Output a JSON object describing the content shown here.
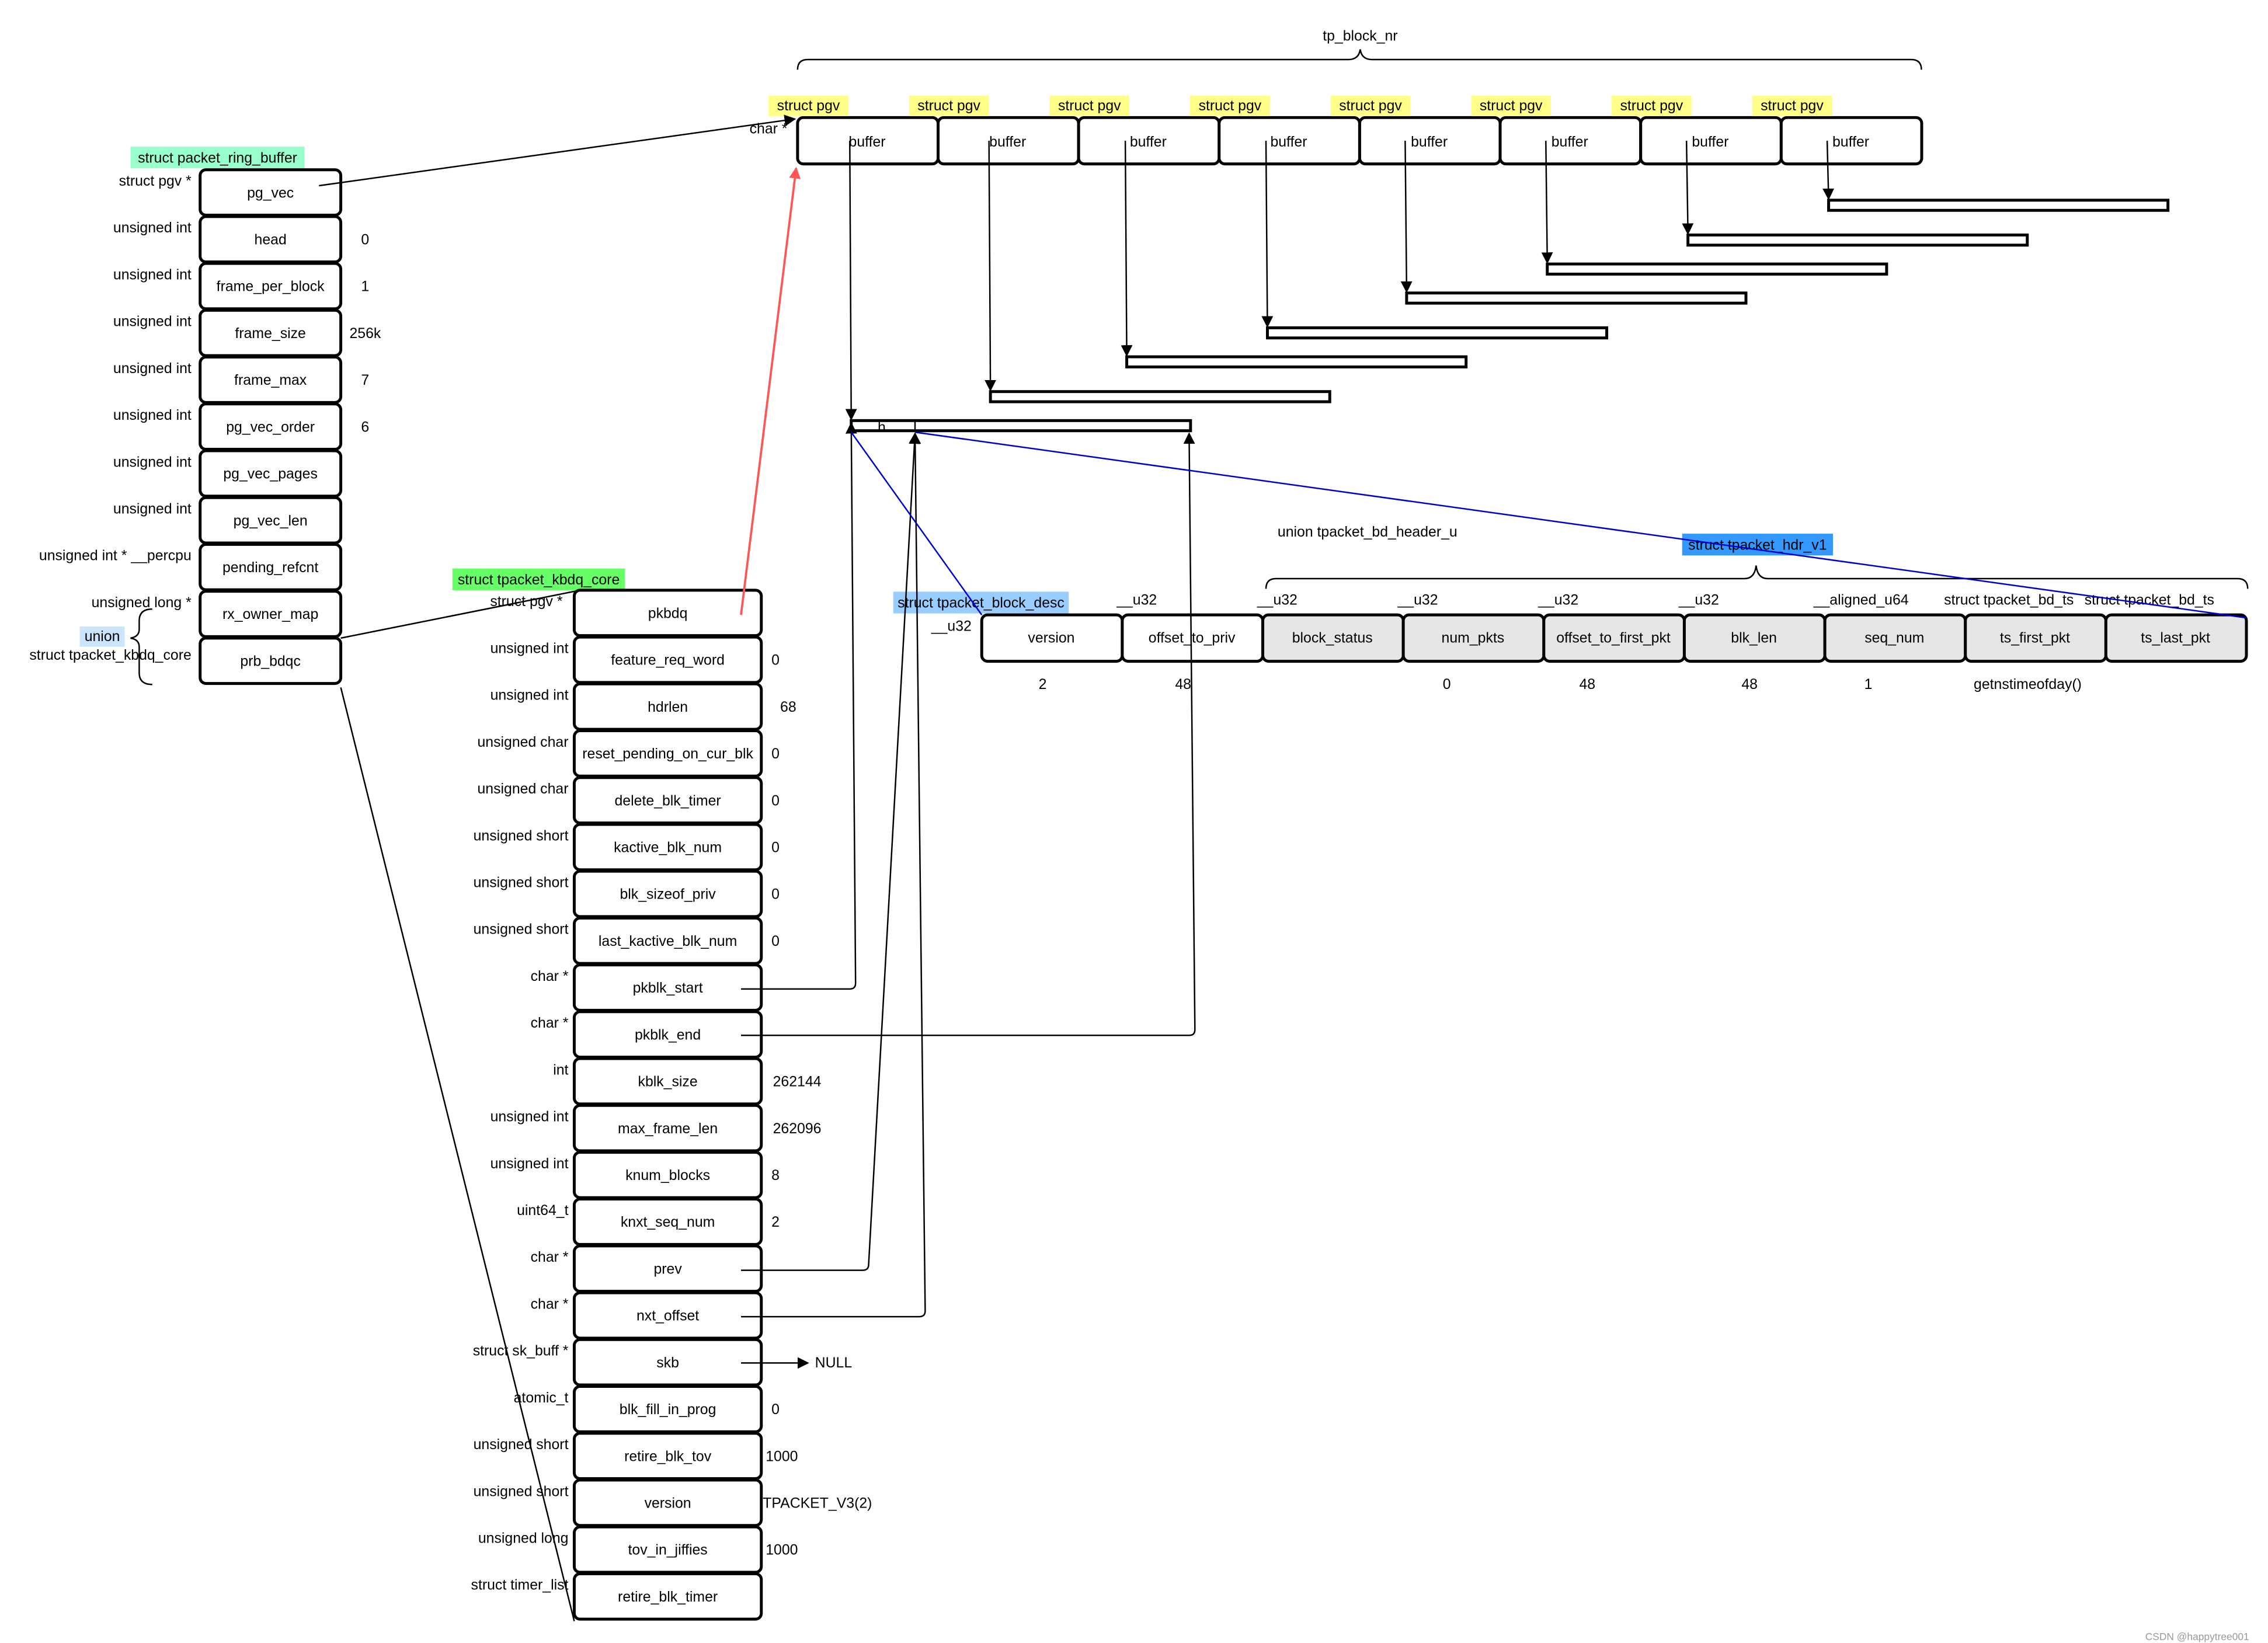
{
  "colors": {
    "ring_buffer_label": "#99ffcc",
    "kbdq_label": "#66ff66",
    "pgv_label": "#ffff88",
    "union_label": "#cce5ff",
    "block_desc_label": "#99ccff",
    "hdr_v1_label": "#3399ff",
    "red_arrow": "#ff5555",
    "blue_line": "#0000cc",
    "brace_pink": "#ff88ff"
  },
  "top": {
    "title": "tp_block_nr",
    "char_ptr": "char *",
    "pgv_label": "struct pgv",
    "buffer_label": "buffer",
    "count": 8
  },
  "ring_buffer": {
    "title": "struct packet_ring_buffer",
    "fields": [
      {
        "type": "struct pgv *",
        "name": "pg_vec",
        "value": ""
      },
      {
        "type": "unsigned int",
        "name": "head",
        "value": "0"
      },
      {
        "type": "unsigned int",
        "name": "frame_per_block",
        "value": "1"
      },
      {
        "type": "unsigned int",
        "name": "frame_size",
        "value": "256k"
      },
      {
        "type": "unsigned int",
        "name": "frame_max",
        "value": "7"
      },
      {
        "type": "unsigned int",
        "name": "pg_vec_order",
        "value": "6"
      },
      {
        "type": "unsigned int",
        "name": "pg_vec_pages",
        "value": ""
      },
      {
        "type": "unsigned int",
        "name": "pg_vec_len",
        "value": ""
      },
      {
        "type": "unsigned int * __percpu",
        "name": "pending_refcnt",
        "value": ""
      },
      {
        "type": "unsigned long *",
        "name": "rx_owner_map",
        "value": ""
      },
      {
        "type": "struct tpacket_kbdq_core",
        "name": "prb_bdqc",
        "value": ""
      }
    ],
    "union_label": "union"
  },
  "kbdq": {
    "title": "struct tpacket_kbdq_core",
    "fields": [
      {
        "type": "struct pgv *",
        "name": "pkbdq",
        "value": ""
      },
      {
        "type": "unsigned int",
        "name": "feature_req_word",
        "value": "0"
      },
      {
        "type": "unsigned int",
        "name": "hdrlen",
        "value": "68"
      },
      {
        "type": "unsigned char",
        "name": "reset_pending_on_cur_blk",
        "value": "0"
      },
      {
        "type": "unsigned char",
        "name": "delete_blk_timer",
        "value": "0"
      },
      {
        "type": "unsigned short",
        "name": "kactive_blk_num",
        "value": "0"
      },
      {
        "type": "unsigned short",
        "name": "blk_sizeof_priv",
        "value": "0"
      },
      {
        "type": "unsigned short",
        "name": "last_kactive_blk_num",
        "value": "0"
      },
      {
        "type": "char *",
        "name": "pkblk_start",
        "value": ""
      },
      {
        "type": "char *",
        "name": "pkblk_end",
        "value": ""
      },
      {
        "type": "int",
        "name": "kblk_size",
        "value": "262144"
      },
      {
        "type": "unsigned int",
        "name": "max_frame_len",
        "value": "262096"
      },
      {
        "type": "unsigned int",
        "name": "knum_blocks",
        "value": "8"
      },
      {
        "type": "uint64_t",
        "name": "knxt_seq_num",
        "value": "2"
      },
      {
        "type": "char *",
        "name": "prev",
        "value": ""
      },
      {
        "type": "char *",
        "name": "nxt_offset",
        "value": ""
      },
      {
        "type": "struct sk_buff *",
        "name": "skb",
        "value": "NULL"
      },
      {
        "type": "atomic_t",
        "name": "blk_fill_in_prog",
        "value": "0"
      },
      {
        "type": "unsigned short",
        "name": "retire_blk_tov",
        "value": "1000"
      },
      {
        "type": "unsigned short",
        "name": "version",
        "value": "TPACKET_V3(2)"
      },
      {
        "type": "unsigned long",
        "name": "tov_in_jiffies",
        "value": "1000"
      },
      {
        "type": "struct timer_list",
        "name": "retire_blk_timer",
        "value": ""
      }
    ]
  },
  "block_desc": {
    "title": "struct tpacket_block_desc",
    "union_title": "union tpacket_bd_header_u",
    "hdr_title": "struct tpacket_hdr_v1",
    "h_label": "h",
    "fields": [
      {
        "type": "__u32",
        "name": "version",
        "value": "2",
        "shaded": false
      },
      {
        "type": "__u32",
        "name": "offset_to_priv",
        "value": "48",
        "shaded": false
      },
      {
        "type": "__u32",
        "name": "block_status",
        "value": "",
        "shaded": true
      },
      {
        "type": "__u32",
        "name": "num_pkts",
        "value": "0",
        "shaded": true
      },
      {
        "type": "__u32",
        "name": "offset_to_first_pkt",
        "value": "48",
        "shaded": true
      },
      {
        "type": "__u32",
        "name": "blk_len",
        "value": "48",
        "shaded": true
      },
      {
        "type": "__aligned_u64",
        "name": "seq_num",
        "value": "1",
        "shaded": true
      },
      {
        "type": "struct tpacket_bd_ts",
        "name": "ts_first_pkt",
        "value": "getnstimeofday()",
        "shaded": true
      },
      {
        "type": "struct tpacket_bd_ts",
        "name": "ts_last_pkt",
        "value": "",
        "shaded": true
      }
    ]
  },
  "watermark": "CSDN @happytree001"
}
